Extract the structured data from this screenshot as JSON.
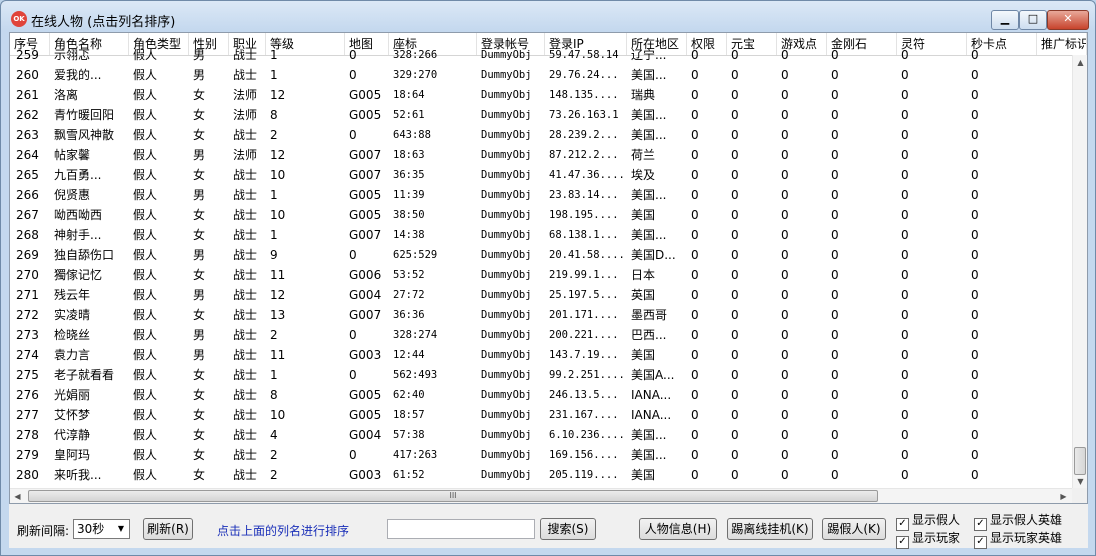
{
  "window": {
    "title": "在线人物 (点击列名排序)",
    "app_icon_text": "OK",
    "minimize_glyph": "▁",
    "maximize_glyph": "□",
    "close_glyph": "✕"
  },
  "columns": [
    "序号",
    "角色名称",
    "角色类型",
    "性别",
    "职业",
    "等级",
    "地图",
    "座标",
    "登录帐号",
    "登录IP",
    "所在地区",
    "权限",
    "元宝",
    "游戏点",
    "金刚石",
    "灵符",
    "秒卡点",
    "推广标识"
  ],
  "rows": [
    [
      "259",
      "示翎忑",
      "假人",
      "男",
      "战士",
      "1",
      "0",
      "328:266",
      "DummyObj",
      "59.47.58.14",
      "辽宁...",
      "0",
      "0",
      "0",
      "0",
      "0",
      "0"
    ],
    [
      "260",
      "爱我的...",
      "假人",
      "男",
      "战士",
      "1",
      "0",
      "329:270",
      "DummyObj",
      "29.76.24...",
      "美国...",
      "0",
      "0",
      "0",
      "0",
      "0",
      "0"
    ],
    [
      "261",
      "洛离",
      "假人",
      "女",
      "法师",
      "12",
      "G005",
      "18:64",
      "DummyObj",
      "148.135....",
      "瑞典",
      "0",
      "0",
      "0",
      "0",
      "0",
      "0"
    ],
    [
      "262",
      "青竹暖回阳",
      "假人",
      "女",
      "法师",
      "8",
      "G005",
      "52:61",
      "DummyObj",
      "73.26.163.1",
      "美国...",
      "0",
      "0",
      "0",
      "0",
      "0",
      "0"
    ],
    [
      "263",
      "飘雪风神散",
      "假人",
      "女",
      "战士",
      "2",
      "0",
      "643:88",
      "DummyObj",
      "28.239.2...",
      "美国...",
      "0",
      "0",
      "0",
      "0",
      "0",
      "0"
    ],
    [
      "264",
      "帖家馨",
      "假人",
      "男",
      "法师",
      "12",
      "G007",
      "18:63",
      "DummyObj",
      "87.212.2...",
      "荷兰",
      "0",
      "0",
      "0",
      "0",
      "0",
      "0"
    ],
    [
      "265",
      "九百勇...",
      "假人",
      "女",
      "战士",
      "10",
      "G007",
      "36:35",
      "DummyObj",
      "41.47.36....",
      "埃及",
      "0",
      "0",
      "0",
      "0",
      "0",
      "0"
    ],
    [
      "266",
      "倪贤惠",
      "假人",
      "男",
      "战士",
      "1",
      "G005",
      "11:39",
      "DummyObj",
      "23.83.14...",
      "美国...",
      "0",
      "0",
      "0",
      "0",
      "0",
      "0"
    ],
    [
      "267",
      "呦西呦西",
      "假人",
      "女",
      "战士",
      "10",
      "G005",
      "38:50",
      "DummyObj",
      "198.195....",
      "美国",
      "0",
      "0",
      "0",
      "0",
      "0",
      "0"
    ],
    [
      "268",
      "神射手...",
      "假人",
      "女",
      "战士",
      "1",
      "G007",
      "14:38",
      "DummyObj",
      "68.138.1...",
      "美国...",
      "0",
      "0",
      "0",
      "0",
      "0",
      "0"
    ],
    [
      "269",
      "独自舔伤口",
      "假人",
      "男",
      "战士",
      "9",
      "0",
      "625:529",
      "DummyObj",
      "20.41.58....",
      "美国D...",
      "0",
      "0",
      "0",
      "0",
      "0",
      "0"
    ],
    [
      "270",
      "獨傢记忆",
      "假人",
      "女",
      "战士",
      "11",
      "G006",
      "53:52",
      "DummyObj",
      "219.99.1...",
      "日本",
      "0",
      "0",
      "0",
      "0",
      "0",
      "0"
    ],
    [
      "271",
      "残云年",
      "假人",
      "男",
      "战士",
      "12",
      "G004",
      "27:72",
      "DummyObj",
      "25.197.5...",
      "英国",
      "0",
      "0",
      "0",
      "0",
      "0",
      "0"
    ],
    [
      "272",
      "实凌晴",
      "假人",
      "女",
      "战士",
      "13",
      "G007",
      "36:36",
      "DummyObj",
      "201.171....",
      "墨西哥",
      "0",
      "0",
      "0",
      "0",
      "0",
      "0"
    ],
    [
      "273",
      "检晓丝",
      "假人",
      "男",
      "战士",
      "2",
      "0",
      "328:274",
      "DummyObj",
      "200.221....",
      "巴西...",
      "0",
      "0",
      "0",
      "0",
      "0",
      "0"
    ],
    [
      "274",
      "袁力言",
      "假人",
      "男",
      "战士",
      "11",
      "G003",
      "12:44",
      "DummyObj",
      "143.7.19...",
      "美国",
      "0",
      "0",
      "0",
      "0",
      "0",
      "0"
    ],
    [
      "275",
      "老子就看看",
      "假人",
      "女",
      "战士",
      "1",
      "0",
      "562:493",
      "DummyObj",
      "99.2.251....",
      "美国A...",
      "0",
      "0",
      "0",
      "0",
      "0",
      "0"
    ],
    [
      "276",
      "光娟丽",
      "假人",
      "女",
      "战士",
      "8",
      "G005",
      "62:40",
      "DummyObj",
      "246.13.5...",
      "IANA...",
      "0",
      "0",
      "0",
      "0",
      "0",
      "0"
    ],
    [
      "277",
      "艾怀梦",
      "假人",
      "女",
      "战士",
      "10",
      "G005",
      "18:57",
      "DummyObj",
      "231.167....",
      "IANA...",
      "0",
      "0",
      "0",
      "0",
      "0",
      "0"
    ],
    [
      "278",
      "代淳静",
      "假人",
      "女",
      "战士",
      "4",
      "G004",
      "57:38",
      "DummyObj",
      "6.10.236....",
      "美国...",
      "0",
      "0",
      "0",
      "0",
      "0",
      "0"
    ],
    [
      "279",
      "皇阿玛",
      "假人",
      "女",
      "战士",
      "2",
      "0",
      "417:263",
      "DummyObj",
      "169.156....",
      "美国...",
      "0",
      "0",
      "0",
      "0",
      "0",
      "0"
    ],
    [
      "280",
      "来听我...",
      "假人",
      "女",
      "战士",
      "2",
      "G003",
      "61:52",
      "DummyObj",
      "205.119....",
      "美国",
      "0",
      "0",
      "0",
      "0",
      "0",
      "0"
    ]
  ],
  "scrollbar": {
    "up": "▲",
    "down": "▼",
    "left": "◀",
    "right": "▶",
    "grip": "III"
  },
  "bottom": {
    "refresh_label": "刷新间隔:",
    "refresh_value": "30秒",
    "refresh_button": "刷新(R)",
    "hint": "点击上面的列名进行排序",
    "search_value": "",
    "search_button": "搜索(S)",
    "info_button": "人物信息(H)",
    "kick_offline_button": "踢离线挂机(K)",
    "kick_dummy_button": "踢假人(K)",
    "check_show_dummy": "显示假人",
    "check_show_player": "显示玩家",
    "check_show_dummy_hero": "显示假人英雄",
    "check_show_player_hero": "显示玩家英雄",
    "check_mark": "✓"
  }
}
